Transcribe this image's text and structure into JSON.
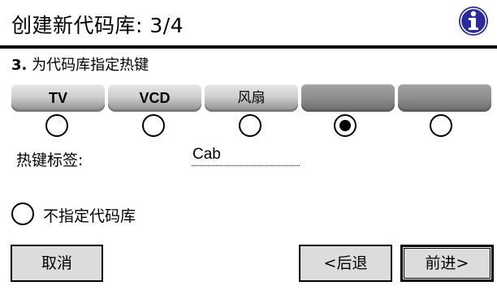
{
  "dialog": {
    "title": "创建新代码库: 3/4",
    "info_icon": "info-icon"
  },
  "step": {
    "number": "3.",
    "text": "为代码库指定热键"
  },
  "hotkeys": [
    {
      "label": "TV",
      "selected": false
    },
    {
      "label": "VCD",
      "selected": false
    },
    {
      "label": "风扇",
      "selected": false
    },
    {
      "label": "",
      "selected": true
    },
    {
      "label": "",
      "selected": false
    }
  ],
  "label_field": {
    "caption": "热键标签:",
    "value": "Cab"
  },
  "no_library": {
    "label": "不指定代码库",
    "selected": false
  },
  "buttons": {
    "cancel": "取消",
    "back": "<后退",
    "next": "前进>"
  },
  "colors": {
    "info_icon_fill": "#2a2a9c",
    "button_face": "#dcdcdc"
  }
}
